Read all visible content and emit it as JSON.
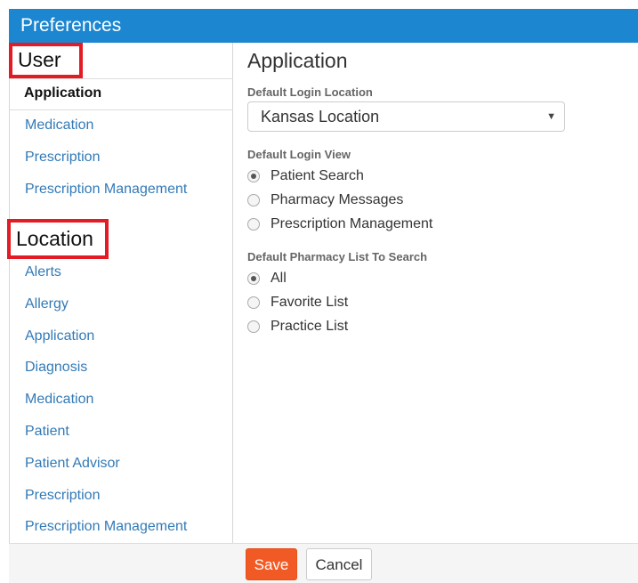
{
  "window": {
    "title": "Preferences"
  },
  "sidebar": {
    "user_header": "User",
    "user_items": [
      {
        "label": "Application",
        "active": true
      },
      {
        "label": "Medication"
      },
      {
        "label": "Prescription"
      },
      {
        "label": "Prescription Management"
      }
    ],
    "location_header": "Location",
    "location_items": [
      {
        "label": "Alerts"
      },
      {
        "label": "Allergy"
      },
      {
        "label": "Application"
      },
      {
        "label": "Diagnosis"
      },
      {
        "label": "Medication"
      },
      {
        "label": "Patient"
      },
      {
        "label": "Patient Advisor"
      },
      {
        "label": "Prescription"
      },
      {
        "label": "Prescription Management"
      }
    ]
  },
  "main": {
    "title": "Application",
    "default_login_location": {
      "label": "Default Login Location",
      "selected": "Kansas Location"
    },
    "default_login_view": {
      "label": "Default Login View",
      "options": [
        "Patient Search",
        "Pharmacy Messages",
        "Prescription Management"
      ],
      "selected": "Patient Search"
    },
    "default_pharmacy_list": {
      "label": "Default Pharmacy List To Search",
      "options": [
        "All",
        "Favorite List",
        "Practice List"
      ],
      "selected": "All"
    }
  },
  "footer": {
    "save_label": "Save",
    "cancel_label": "Cancel"
  },
  "colors": {
    "titlebar": "#1c86d0",
    "accent_save": "#f15a24",
    "link": "#337ab7",
    "highlight_box": "#e21b25"
  }
}
